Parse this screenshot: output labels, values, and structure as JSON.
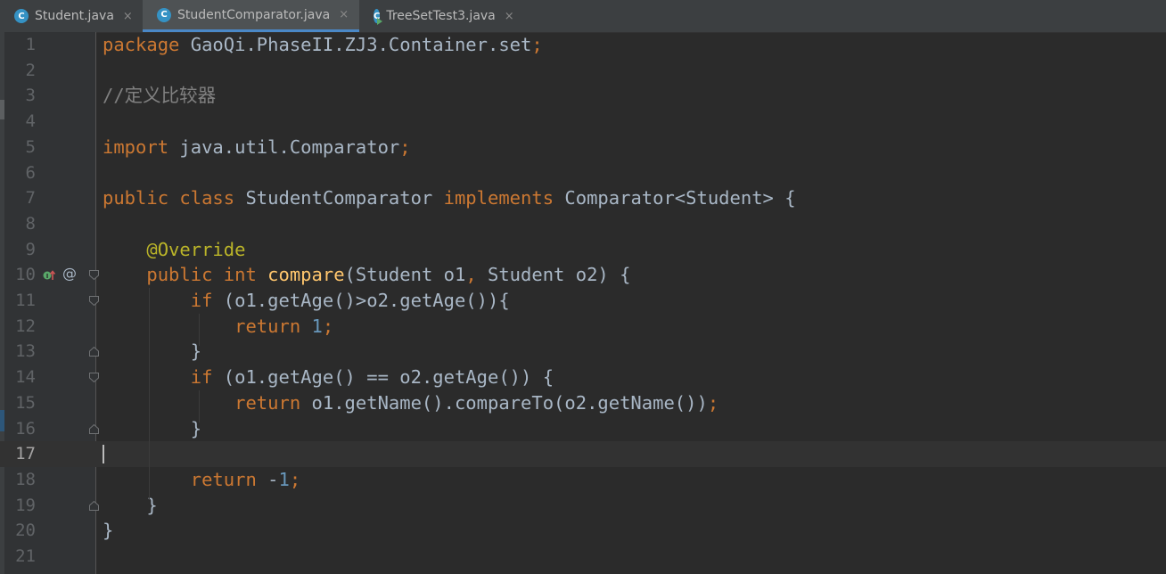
{
  "tabs": [
    {
      "label": "Student.java",
      "icon": "class-icon",
      "active": false
    },
    {
      "label": "StudentComparator.java",
      "icon": "class-icon",
      "active": true
    },
    {
      "label": "TreeSetTest3.java",
      "icon": "runnable-class-icon",
      "active": false
    }
  ],
  "tab_close_glyph": "×",
  "editor": {
    "current_line": 17,
    "line_numbers": [
      "1",
      "2",
      "3",
      "4",
      "5",
      "6",
      "7",
      "8",
      "9",
      "10",
      "11",
      "12",
      "13",
      "14",
      "15",
      "16",
      "17",
      "18",
      "19",
      "20",
      "21"
    ],
    "lines": [
      [
        {
          "t": "kw",
          "v": "package "
        },
        {
          "t": "p",
          "v": "GaoQi.PhaseII.ZJ3.Container.set"
        },
        {
          "t": "kw",
          "v": ";"
        }
      ],
      [],
      [
        {
          "t": "cm",
          "v": "//定义比较器"
        }
      ],
      [],
      [
        {
          "t": "kw",
          "v": "import "
        },
        {
          "t": "p",
          "v": "java.util.Comparator"
        },
        {
          "t": "kw",
          "v": ";"
        }
      ],
      [],
      [
        {
          "t": "kw",
          "v": "public class "
        },
        {
          "t": "p",
          "v": "StudentComparator "
        },
        {
          "t": "kw",
          "v": "implements "
        },
        {
          "t": "p",
          "v": "Comparator<Student> {"
        }
      ],
      [],
      [
        {
          "t": "p",
          "v": "    "
        },
        {
          "t": "ann",
          "v": "@Override"
        }
      ],
      [
        {
          "t": "p",
          "v": "    "
        },
        {
          "t": "kw",
          "v": "public int "
        },
        {
          "t": "fn",
          "v": "compare"
        },
        {
          "t": "p",
          "v": "(Student o1"
        },
        {
          "t": "kw",
          "v": ", "
        },
        {
          "t": "p",
          "v": "Student o2) {"
        }
      ],
      [
        {
          "t": "p",
          "v": "        "
        },
        {
          "t": "kw",
          "v": "if "
        },
        {
          "t": "p",
          "v": "(o1.getAge()>o2.getAge()){"
        }
      ],
      [
        {
          "t": "p",
          "v": "            "
        },
        {
          "t": "kw",
          "v": "return "
        },
        {
          "t": "num",
          "v": "1"
        },
        {
          "t": "kw",
          "v": ";"
        }
      ],
      [
        {
          "t": "p",
          "v": "        }"
        }
      ],
      [
        {
          "t": "p",
          "v": "        "
        },
        {
          "t": "kw",
          "v": "if "
        },
        {
          "t": "p",
          "v": "(o1.getAge() == o2.getAge()) {"
        }
      ],
      [
        {
          "t": "p",
          "v": "            "
        },
        {
          "t": "kw",
          "v": "return "
        },
        {
          "t": "p",
          "v": "o1.getName().compareTo(o2.getName())"
        },
        {
          "t": "kw",
          "v": ";"
        }
      ],
      [
        {
          "t": "p",
          "v": "        }"
        }
      ],
      [],
      [
        {
          "t": "p",
          "v": "        "
        },
        {
          "t": "kw",
          "v": "return "
        },
        {
          "t": "p",
          "v": "-"
        },
        {
          "t": "num",
          "v": "1"
        },
        {
          "t": "kw",
          "v": ";"
        }
      ],
      [
        {
          "t": "p",
          "v": "    }"
        }
      ],
      [
        {
          "t": "p",
          "v": "}"
        }
      ],
      []
    ]
  },
  "gutter": {
    "implements_marker_line": 10,
    "implements_icon": "overrides-method-icon",
    "annotation_marker": "@",
    "fold_open_lines": [
      10,
      11,
      14
    ],
    "fold_close_lines": [
      13,
      16,
      19
    ]
  },
  "colors": {
    "background": "#2b2b2b",
    "keyword": "#cc7832",
    "annotation": "#bbb529",
    "comment": "#808080",
    "number": "#6897bb",
    "method": "#ffc66d",
    "plain": "#a9b7c6",
    "active_tab_underline": "#4a88c7"
  }
}
